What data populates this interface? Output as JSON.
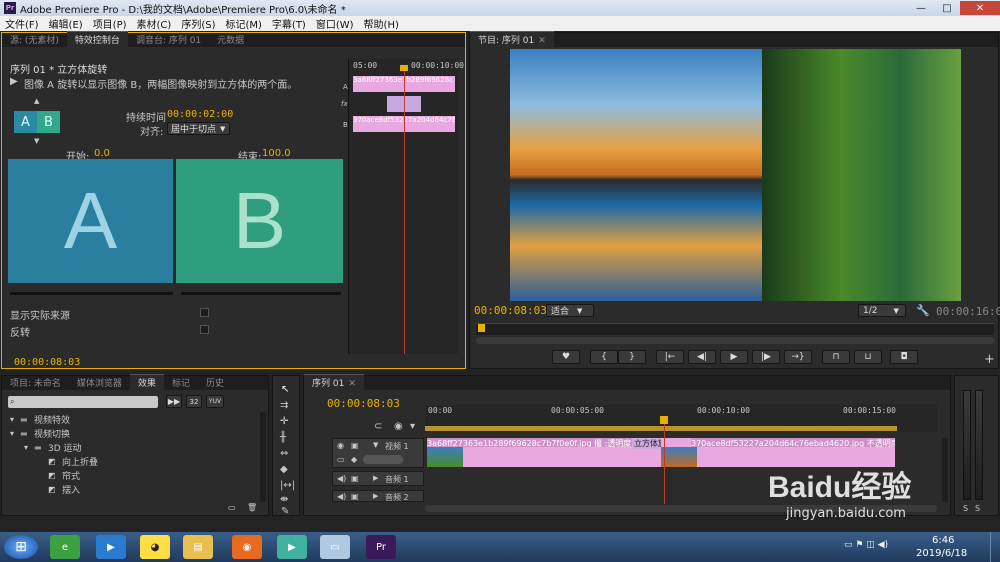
{
  "window": {
    "app": "Pr",
    "title": "Adobe Premiere Pro - D:\\我的文档\\Adobe\\Premiere Pro\\6.0\\未命名 *",
    "minimize": "—",
    "maximize": "□",
    "close": "✕"
  },
  "menu": [
    "文件(F)",
    "编辑(E)",
    "项目(P)",
    "素材(C)",
    "序列(S)",
    "标记(M)",
    "字幕(T)",
    "窗口(W)",
    "帮助(H)"
  ],
  "effect_controls": {
    "tabs": [
      "源: (无素材)",
      "特效控制台",
      "调音台: 序列 01",
      "元数据"
    ],
    "active_tab": "特效控制台",
    "sequence_title": "序列 01 * 立方体旋转",
    "description": "图像 A 旋转以显示图像 B，两幅图像映射到立方体的两个面。",
    "thumb_a": "A",
    "thumb_b": "B",
    "duration_label": "持续时间",
    "duration_value": "00:00:02:00",
    "align_label": "对齐:",
    "align_value": "居中于切点",
    "start_label": "开始:",
    "start_value": "0.0",
    "end_label": "结束:",
    "end_value": "100.0",
    "big_a": "A",
    "big_b": "B",
    "show_actual_sources": "显示实际来源",
    "reverse": "反转",
    "current_time": "00:00:08:03",
    "mini_timeline": {
      "t_start": "05:00",
      "t_end": "00:00:10:00",
      "track_a": "A",
      "track_b": "B",
      "clip_a_label": "3a68ff27363e1b289f69628c",
      "clip_b_label": "370ace8df53227a204d64c76",
      "fx": "fx"
    }
  },
  "program_monitor": {
    "tab": "节目: 序列 01",
    "timecode": "00:00:08:03",
    "fit": "适合",
    "ratio": "1/2",
    "duration": "00:00:16:00",
    "buttons": [
      "marker-button",
      "in-point-button",
      "out-point-button",
      "go-to-in-button",
      "step-back-button",
      "play-button",
      "step-forward-button",
      "go-to-out-button",
      "lift-button",
      "extract-button",
      "export-frame-button"
    ],
    "button_glyphs": [
      "♥",
      "{",
      "}",
      "|←",
      "◀|",
      "▶",
      "|▶",
      "→}",
      "⊓",
      "⊔",
      "◘"
    ],
    "add": "+"
  },
  "project": {
    "tabs": [
      "项目: 未命名",
      "媒体浏览器",
      "效果",
      "标记",
      "历史"
    ],
    "active_tab": "效果",
    "search_placeholder": "",
    "filters": [
      "32",
      "YUV"
    ],
    "tree": [
      {
        "label": "视频特效",
        "indent": 0,
        "icon": "folder"
      },
      {
        "label": "视频切换",
        "indent": 0,
        "icon": "folder"
      },
      {
        "label": "3D 运动",
        "indent": 1,
        "icon": "folder"
      },
      {
        "label": "向上折叠",
        "indent": 2,
        "icon": "effect"
      },
      {
        "label": "帘式",
        "indent": 2,
        "icon": "effect"
      },
      {
        "label": "摆入",
        "indent": 2,
        "icon": "effect"
      }
    ]
  },
  "timeline": {
    "tab": "序列 01",
    "timecode": "00:00:08:03",
    "ruler": [
      "00:00",
      "00:00:05:00",
      "00:00:10:00",
      "00:00:15:00"
    ],
    "tracks": [
      {
        "name": "视频 1"
      },
      {
        "name": "音频 1"
      },
      {
        "name": "音频 2"
      }
    ],
    "clip1": "3a68ff27363e1b289f69628c7b7f0e0f.jpg 撮 :透明度",
    "transition": "立方体旋转",
    "clip2": "370ace8df53227a204d64c76ebad4620.jpg 不透明度"
  },
  "audio_meter": {
    "left": "S",
    "right": "S"
  },
  "taskbar": {
    "clock_time": "6:46",
    "clock_date": "2019/6/18",
    "start": "⊞",
    "apps": [
      "browser-icon",
      "media-icon",
      "qq-icon",
      "explorer-icon",
      "firefox-icon",
      "app-icon",
      "window-icon",
      "premiere-icon"
    ],
    "app_glyphs": [
      "e",
      "▶",
      "◕",
      "▤",
      "◉",
      "▶",
      "▭",
      "Pr"
    ]
  },
  "watermark": {
    "line1": "Baidu经验",
    "line2": "jingyan.baidu.com"
  },
  "colors": {
    "accent": "#e8b300",
    "teal_a": "#2a8aa3",
    "teal_b": "#31a88a",
    "clip_pink": "#e9a8e0",
    "playhead": "#c0392b"
  }
}
